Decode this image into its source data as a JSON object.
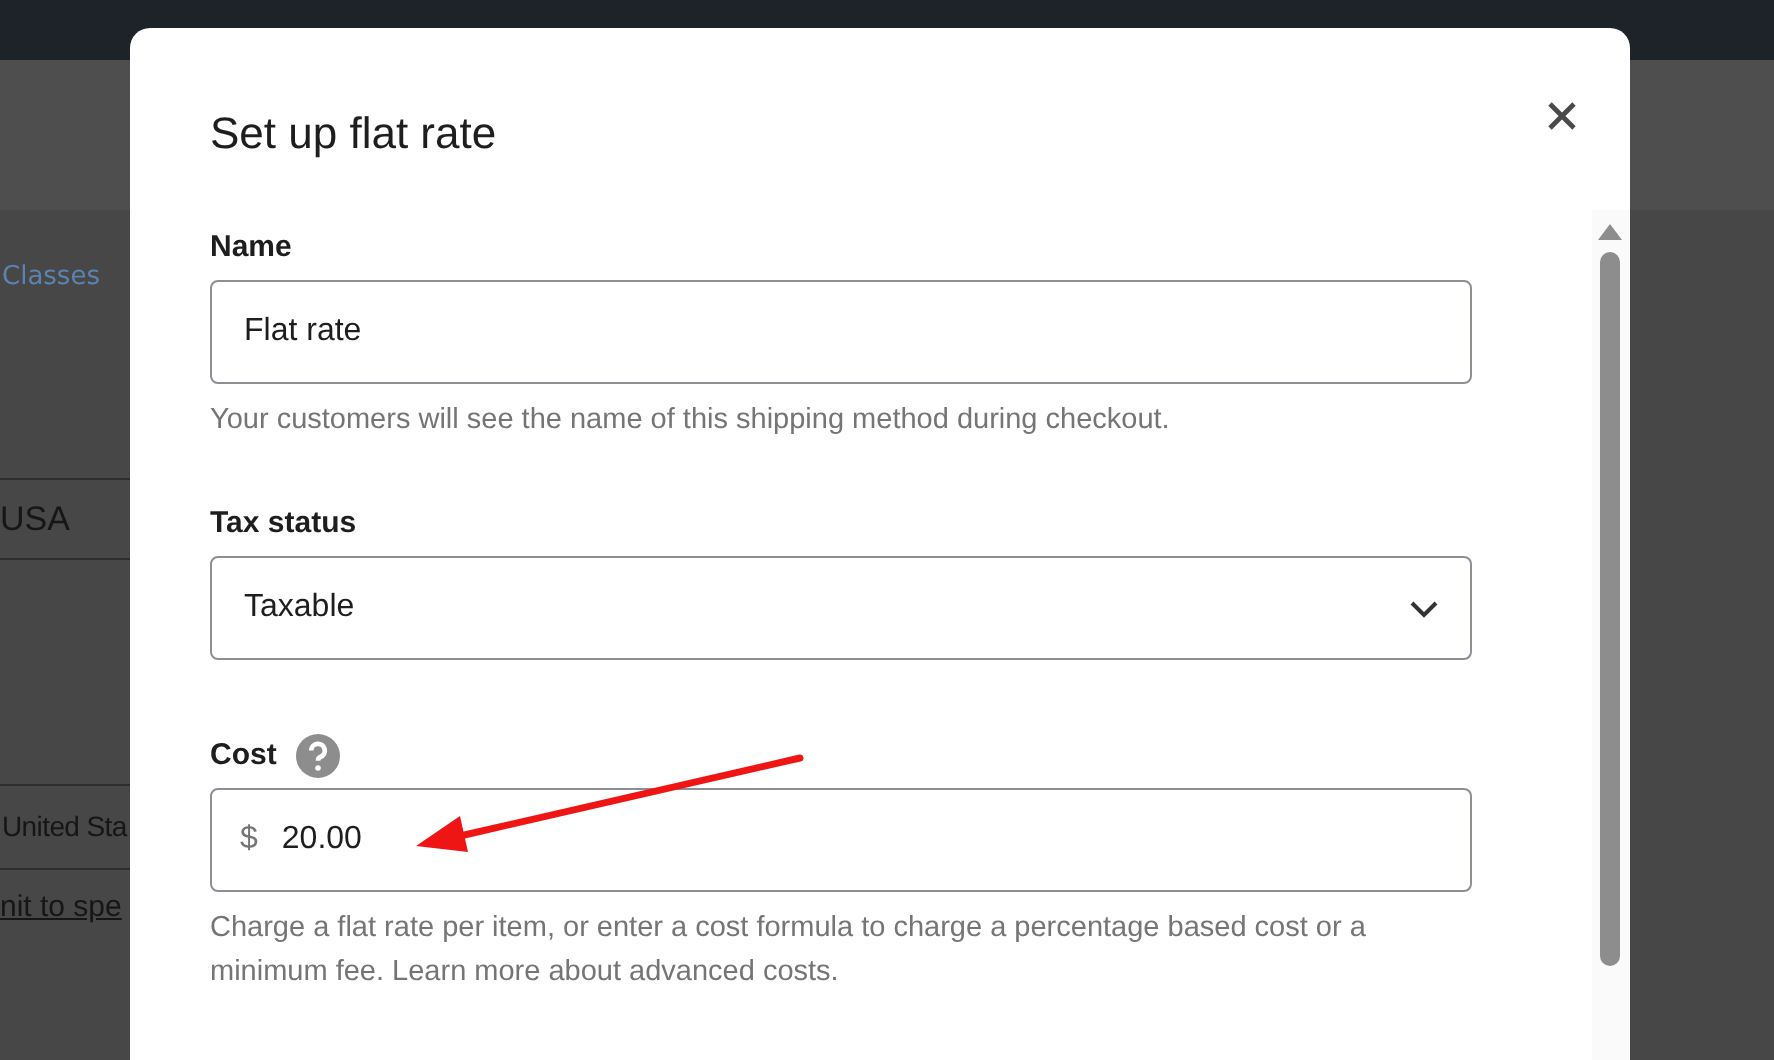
{
  "background": {
    "link": "Classes",
    "rows": [
      {
        "kind": "cell",
        "text": "USA"
      },
      {
        "kind": "cell",
        "text": "United Sta"
      },
      {
        "kind": "link",
        "text": "nit to spe"
      }
    ]
  },
  "dialog": {
    "title": "Set up flat rate",
    "fields": [
      {
        "kind": "text",
        "label": "Name",
        "value": "Flat rate",
        "help": "Your customers will see the name of this shipping method during checkout."
      },
      {
        "kind": "select",
        "label": "Tax status",
        "value": "Taxable"
      },
      {
        "kind": "money",
        "label": "Cost",
        "help_icon": true,
        "prefix": "$",
        "value": "20.00",
        "help": "Charge a flat rate per item, or enter a cost formula to charge a percentage based cost or a minimum fee. Learn more about advanced costs."
      }
    ]
  }
}
